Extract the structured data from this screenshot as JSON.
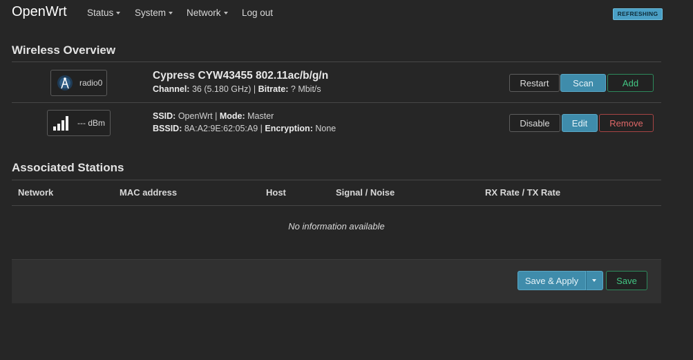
{
  "header": {
    "brand": "OpenWrt",
    "menu": [
      {
        "label": "Status",
        "dropdown": true
      },
      {
        "label": "System",
        "dropdown": true
      },
      {
        "label": "Network",
        "dropdown": true
      },
      {
        "label": "Log out",
        "dropdown": false
      }
    ],
    "status_badge": "REFRESHING"
  },
  "wireless_overview": {
    "heading": "Wireless Overview",
    "radio": {
      "badge_label": "radio0",
      "icon": "wifi-antenna-icon",
      "title": "Cypress CYW43455 802.11ac/b/g/n",
      "channel_label": "Channel:",
      "channel_value": "36 (5.180 GHz)",
      "bitrate_label": "Bitrate:",
      "bitrate_value": "? Mbit/s",
      "buttons": {
        "restart": "Restart",
        "scan": "Scan",
        "add": "Add"
      }
    },
    "network": {
      "badge_label": "--- dBm",
      "icon": "signal-bars-icon",
      "ssid_label": "SSID:",
      "ssid_value": "OpenWrt",
      "mode_label": "Mode:",
      "mode_value": "Master",
      "bssid_label": "BSSID:",
      "bssid_value": "8A:A2:9E:62:05:A9",
      "encryption_label": "Encryption:",
      "encryption_value": "None",
      "buttons": {
        "disable": "Disable",
        "edit": "Edit",
        "remove": "Remove"
      }
    }
  },
  "associated_stations": {
    "heading": "Associated Stations",
    "columns": [
      "Network",
      "MAC address",
      "Host",
      "Signal / Noise",
      "RX Rate / TX Rate"
    ],
    "empty_message": "No information available"
  },
  "footer": {
    "save_apply": "Save & Apply",
    "save": "Save"
  },
  "colors": {
    "background": "#262626",
    "accent_blue": "#3f8cab",
    "accent_green": "#43c784",
    "accent_red": "#e06868"
  }
}
